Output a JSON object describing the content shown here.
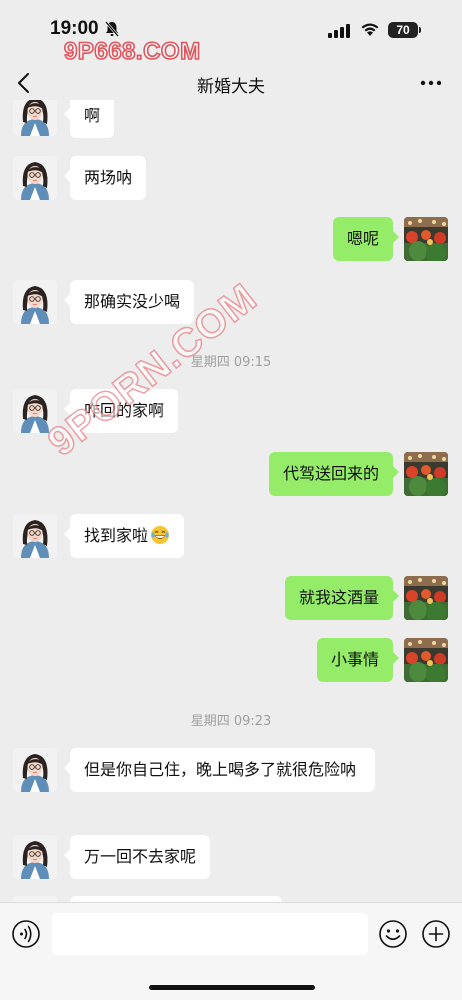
{
  "status_bar": {
    "time": "19:00",
    "battery": "70",
    "watermark": "9P668.COM"
  },
  "header": {
    "title": "新婚大夫",
    "back_icon": "chevron-left-icon",
    "more_icon": "more-dots-icon"
  },
  "watermark_diagonal": "9PORN.COM",
  "messages": [
    {
      "side": "in",
      "text": "啊"
    },
    {
      "side": "in",
      "text": "两场呐"
    },
    {
      "side": "out",
      "text": "嗯呢"
    },
    {
      "side": "in",
      "text": "那确实没少喝"
    },
    {
      "type": "time",
      "text": "星期四 09:15"
    },
    {
      "side": "in",
      "text": "咋回的家啊"
    },
    {
      "side": "out",
      "text": "代驾送回来的"
    },
    {
      "side": "in",
      "text": "找到家啦",
      "emoji": "laughing-tears-emoji"
    },
    {
      "side": "out",
      "text": "就我这酒量"
    },
    {
      "side": "out",
      "text": "小事情"
    },
    {
      "type": "time",
      "text": "星期四 09:23"
    },
    {
      "side": "in",
      "text": "但是你自己住，晚上喝多了就很危险呐"
    },
    {
      "side": "in",
      "text": "万一回不去家呢"
    }
  ],
  "input_bar": {
    "placeholder": "",
    "voice_icon": "voice-icon",
    "emoji_icon": "emoji-face-icon",
    "plus_icon": "plus-circle-icon"
  },
  "colors": {
    "outgoing_bubble": "#95ec69",
    "incoming_bubble": "#ffffff",
    "background": "#ededed",
    "watermark_stroke": "#e2545c"
  }
}
